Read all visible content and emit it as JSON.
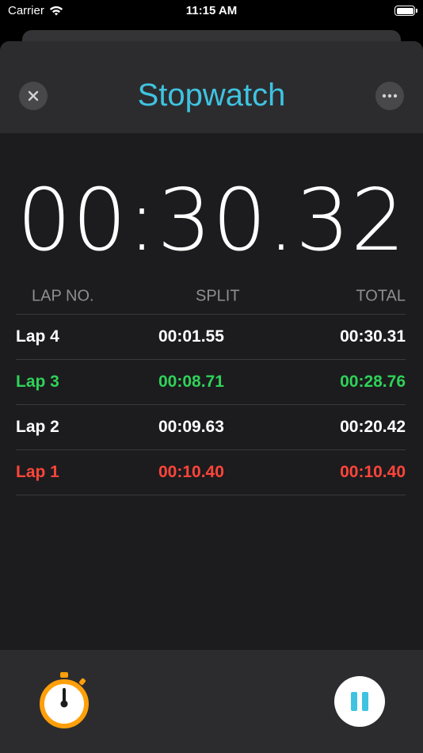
{
  "status": {
    "carrier": "Carrier",
    "time": "11:15 AM"
  },
  "header": {
    "title": "Stopwatch",
    "title_color": "#3fc3e1"
  },
  "timer": {
    "display": "00:30.32"
  },
  "laps": {
    "headers": [
      "LAP NO.",
      "SPLIT",
      "TOTAL"
    ],
    "rows": [
      {
        "lap": "Lap 4",
        "split": "00:01.55",
        "total": "00:30.31",
        "color": "#ffffff"
      },
      {
        "lap": "Lap 3",
        "split": "00:08.71",
        "total": "00:28.76",
        "color": "#30d158"
      },
      {
        "lap": "Lap 2",
        "split": "00:09.63",
        "total": "00:20.42",
        "color": "#ffffff"
      },
      {
        "lap": "Lap 1",
        "split": "00:10.40",
        "total": "00:10.40",
        "color": "#ff453a"
      }
    ]
  },
  "colors": {
    "accent": "#3fc3e1",
    "fastest": "#30d158",
    "slowest": "#ff453a",
    "stopwatch_icon": "#ff9f0a"
  },
  "icons": {
    "close": "close-icon",
    "more": "more-icon",
    "stopwatch": "stopwatch-icon",
    "pause": "pause-icon",
    "wifi": "wifi-icon",
    "battery": "battery-icon"
  }
}
